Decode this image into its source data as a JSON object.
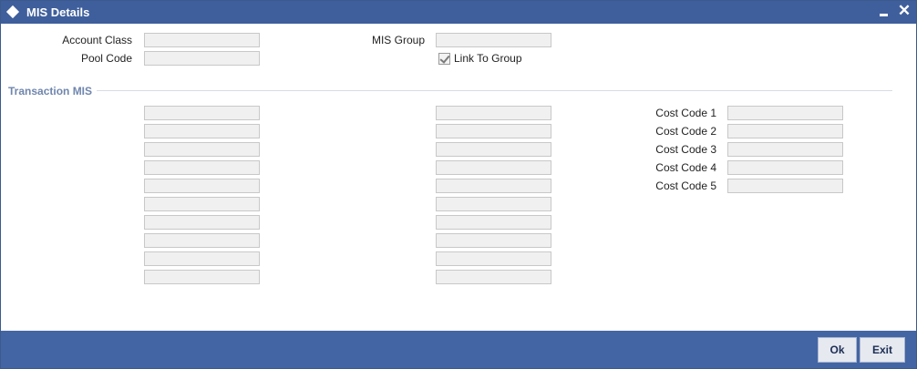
{
  "window": {
    "title": "MIS Details",
    "close_glyph": "✕"
  },
  "header_fields": {
    "account_class": {
      "label": "Account Class",
      "value": ""
    },
    "pool_code": {
      "label": "Pool Code",
      "value": ""
    },
    "mis_group": {
      "label": "MIS Group",
      "value": ""
    },
    "link_to_group": {
      "label": "Link To Group",
      "checked": true
    }
  },
  "transaction_mis": {
    "section_title": "Transaction MIS",
    "column1": [
      "",
      "",
      "",
      "",
      "",
      "",
      "",
      "",
      "",
      ""
    ],
    "column2": [
      "",
      "",
      "",
      "",
      "",
      "",
      "",
      "",
      "",
      ""
    ]
  },
  "cost_codes": [
    {
      "label": "Cost Code 1",
      "value": ""
    },
    {
      "label": "Cost Code 2",
      "value": ""
    },
    {
      "label": "Cost Code 3",
      "value": ""
    },
    {
      "label": "Cost Code 4",
      "value": ""
    },
    {
      "label": "Cost Code 5",
      "value": ""
    }
  ],
  "buttons": {
    "ok": "Ok",
    "exit": "Exit"
  },
  "colors": {
    "titlebar": "#3f5f9c",
    "footer": "#4365a4",
    "section_title": "#6f86ad"
  }
}
